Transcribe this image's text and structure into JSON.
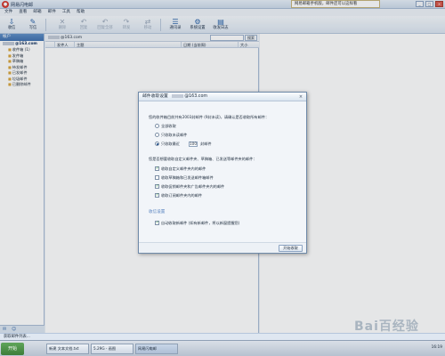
{
  "window": {
    "title": "网易闪电邮",
    "title_ad": "网易邮箱手机版，邮件还可以这样看"
  },
  "menu": [
    "文件",
    "查看",
    "邮箱",
    "邮件",
    "工具",
    "帮助"
  ],
  "toolbar": [
    {
      "label": "收信",
      "icon": "receive-icon",
      "enabled": true
    },
    {
      "label": "写信",
      "icon": "compose-icon",
      "enabled": true
    },
    {
      "label": "删除",
      "icon": "delete-icon",
      "enabled": false
    },
    {
      "label": "回复",
      "icon": "reply-icon",
      "enabled": false
    },
    {
      "label": "回复全部",
      "icon": "reply-all-icon",
      "enabled": false
    },
    {
      "label": "转发",
      "icon": "forward-icon",
      "enabled": false
    },
    {
      "label": "移动",
      "icon": "move-icon",
      "enabled": false
    },
    {
      "label": "通讯录",
      "icon": "contacts-icon",
      "enabled": true
    },
    {
      "label": "系统设置",
      "icon": "settings-icon",
      "enabled": true
    },
    {
      "label": "收发日志",
      "icon": "log-icon",
      "enabled": true
    }
  ],
  "left_panel": {
    "header": "帐户",
    "account": "@163.com",
    "folders": [
      "收件箱 (1)",
      "发件箱",
      "草稿箱",
      "待发邮件",
      "已发邮件",
      "垃圾邮件",
      "已删除邮件"
    ]
  },
  "mail_list": {
    "account": "@163.com",
    "search_button": "搜索",
    "columns": [
      "发件人",
      "主题",
      "日期 (当前周)",
      "大小"
    ]
  },
  "dialog": {
    "title": "邮件收取设置",
    "account": "@163.com",
    "prompt": "您的收件箱目前共有2003封邮件 (9封未读)，请确认是否收取所有邮件：",
    "receive_options": [
      "全部收取",
      "只收取未读邮件",
      "只收取最近"
    ],
    "selected_option": 2,
    "recent_count": "100",
    "recent_suffix": "封邮件",
    "folder_prompt": "您是否想要收取自定义邮件夹、草稿箱、已发送等邮件夹的邮件：",
    "folder_options": [
      {
        "label": "收取自定义邮件夹内的邮件",
        "checked": true
      },
      {
        "label": "收取草稿箱和已发送邮件箱邮件",
        "checked": false
      },
      {
        "label": "收取促销邮件夹和广告邮件夹内的邮件",
        "checked": true
      },
      {
        "label": "收取订阅邮件夹内的邮件",
        "checked": true
      }
    ],
    "auto_section_title": "收信设置",
    "auto_receive_label": "自动收取新邮件 (如有新邮件，将以新窗提醒您)",
    "auto_receive_checked": true,
    "start_button": "开始收取"
  },
  "status": {
    "text": "获取邮件列表..."
  },
  "taskbar": {
    "start": "开始",
    "tasks": [
      "新建 文本文档.txt",
      "5.29G - 画图",
      "网易闪电邮"
    ],
    "active_task": 2,
    "clock": "16:19"
  },
  "watermark": "Bai百经验"
}
